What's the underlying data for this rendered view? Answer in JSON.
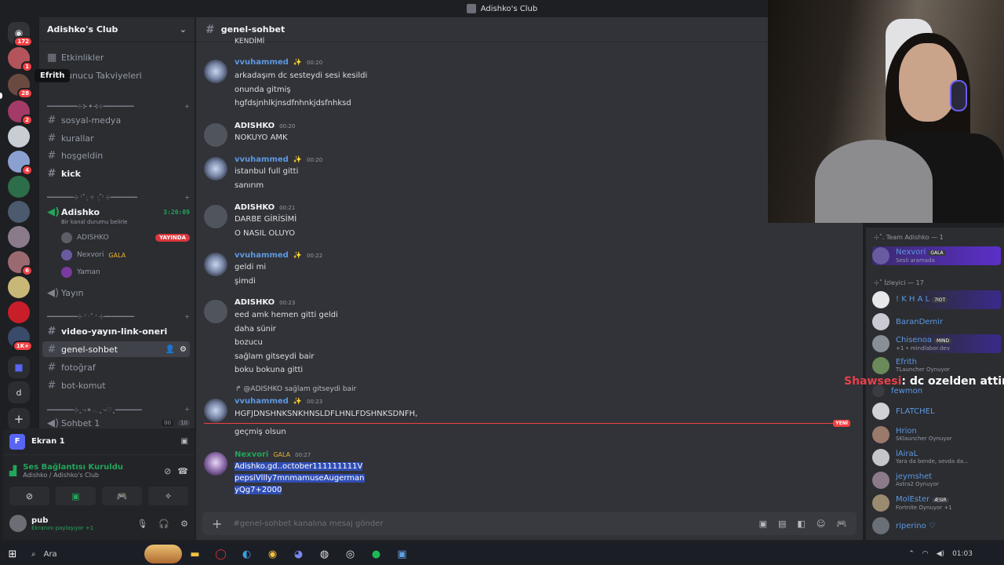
{
  "window": {
    "title": "Adishko's Club"
  },
  "rail": {
    "badges": [
      "172",
      "1",
      "28",
      "2",
      "4",
      "6",
      "1K+"
    ],
    "bottom_letter": "d"
  },
  "tooltip": "Efrith",
  "sidebar": {
    "server_name": "Adishko's Club",
    "top_items": [
      "Etkinlikler",
      "Sunucu Takviyeleri"
    ],
    "cat1": "━━━━━━━━⊹⊱✦⊰⊹━━━━━━━━",
    "text_channels_a": [
      "sosyal-medya",
      "kurallar",
      "hoşgeldin",
      "kick"
    ],
    "cat2": "━━━━━━━⊹ ⁽˚·̩͙ ✧ ·̩͙˚⁾ ⊹━━━━━━━",
    "voice_channel": {
      "name": "Adishko",
      "timer": "3:20:09",
      "status": "Bir kanal durumu belirle",
      "users": [
        {
          "name": "ADISHKO",
          "badge": "YAYINDA"
        },
        {
          "name": "Nexvori",
          "badge": "GALA"
        },
        {
          "name": "Yaman",
          "badge": ""
        }
      ]
    },
    "yayin": "Yayın",
    "cat3": "━━━━━━━━⊹ ⁽ ·˚ ⁾ ⊹━━━━━━━━",
    "text_channels_b": [
      "video-yayın-link-oneri",
      "genel-sohbet",
      "fotoğraf",
      "bot-komut"
    ],
    "cat4": "━━━━━━━⊹˳·˖✶𓂃˳·˖♡˳━━━━━━━",
    "sohbet": {
      "name": "Sohbet 1",
      "count_a": "00",
      "count_b": "10"
    }
  },
  "panel": {
    "screen_label": "Ekran 1",
    "voice_status": "Ses Bağlantısı Kuruldu",
    "voice_location": "Adishko / Adishko's Club",
    "user_name": "pub",
    "user_status": "Ekranını paylaşıyor +1"
  },
  "chat": {
    "channel": "genel-sohbet",
    "messages": [
      {
        "author": "vvuhammed",
        "time": "00:20",
        "lines": [
          "arkadaşım dc sesteydi sesi kesildi",
          "onunda gitmiş",
          "hgfdsjnhlkjnsdfnhnkjdsfnhksd"
        ]
      },
      {
        "author": "ADISHKO",
        "time": "00:20",
        "lines": [
          "NOKUYO AMK"
        ]
      },
      {
        "author": "vvuhammed",
        "time": "00:20",
        "lines": [
          "istanbul full gitti",
          "sanırım"
        ]
      },
      {
        "author": "ADISHKO",
        "time": "00:21",
        "lines": [
          "DARBE GİRİSİMİ",
          "O NASIL OLUYO"
        ]
      },
      {
        "author": "vvuhammed",
        "time": "00:22",
        "lines": [
          "geldi mi",
          "şimdi"
        ]
      },
      {
        "author": "ADISHKO",
        "time": "00:23",
        "lines": [
          "eed amk hemen gitti geldi",
          "daha sünir",
          "bozucu",
          "sağlam gitseydi bair",
          "boku bokuna gitti"
        ]
      },
      {
        "author": "vvuhammed",
        "time": "00:23",
        "lines": [
          "HGFJDNSHNKSNKHNSLDFLHNLFDSHNKSDNFH,"
        ]
      },
      {
        "author": "",
        "time": "",
        "lines": [
          "geçmiş olsun"
        ]
      },
      {
        "author": "Nexvori",
        "badge": "GALA",
        "time": "00:27",
        "lines": [
          "Adishko.gd..october111111111V",
          "pepsiVllly7mnmamuseAugerman",
          "yQg7+2000"
        ]
      }
    ],
    "top_partial": "KENDİMİ",
    "reply_text": "@ADISHKO sağlam gitseydi bair",
    "new_label": "YENİ",
    "composer_placeholder": "#genel-sohbet kanalına mesaj gönder"
  },
  "members": {
    "cat_team": "⊹˚. Team Adishko — 1",
    "cat_viewers": "⊹˚ İzleyici — 17",
    "team": [
      {
        "name": "Nexvori",
        "tag": "GALA",
        "status": "Sesli aramada",
        "color": "#5e98e0"
      }
    ],
    "viewers": [
      {
        "name": "! K H A L",
        "tag": "7IOT",
        "status": "",
        "color": "#5e98e0"
      },
      {
        "name": "BaranDemir",
        "tag": "",
        "status": "",
        "color": "#5e98e0"
      },
      {
        "name": "Chisenoa",
        "tag": "MIND",
        "status": "+1 • mindlabor.dev",
        "color": "#5e98e0"
      },
      {
        "name": "Efrith",
        "tag": "",
        "status": "TLauncher Oynuyor",
        "color": "#5e98e0"
      },
      {
        "name": "fewmon",
        "tag": "",
        "status": "",
        "color": "#5e98e0"
      },
      {
        "name": "FLATCHEL",
        "tag": "",
        "status": "",
        "color": "#5e98e0"
      },
      {
        "name": "Hrion",
        "tag": "",
        "status": "SKlauncher Oynuyor",
        "color": "#5e98e0"
      },
      {
        "name": "lAiraL",
        "tag": "",
        "status": "Yara da bende, sevda da...",
        "color": "#5e98e0"
      },
      {
        "name": "jeymshet",
        "tag": "",
        "status": "Astra2 Oynuyor",
        "color": "#5e98e0"
      },
      {
        "name": "MolEster",
        "tag": "ÆSIR",
        "status": "Fortnite Oynuyor +1",
        "color": "#5e98e0"
      },
      {
        "name": "riperino ♡",
        "tag": "",
        "status": "",
        "color": "#5e98e0"
      }
    ]
  },
  "overlay": {
    "name": "Shawsesi",
    "text": ": dc ozelden attim"
  },
  "taskbar": {
    "search": "Ara",
    "clock": "01:03"
  },
  "colors": {
    "accent": "#5865f2",
    "link": "#5e98e0",
    "green": "#23a55a",
    "red": "#f23f43"
  }
}
